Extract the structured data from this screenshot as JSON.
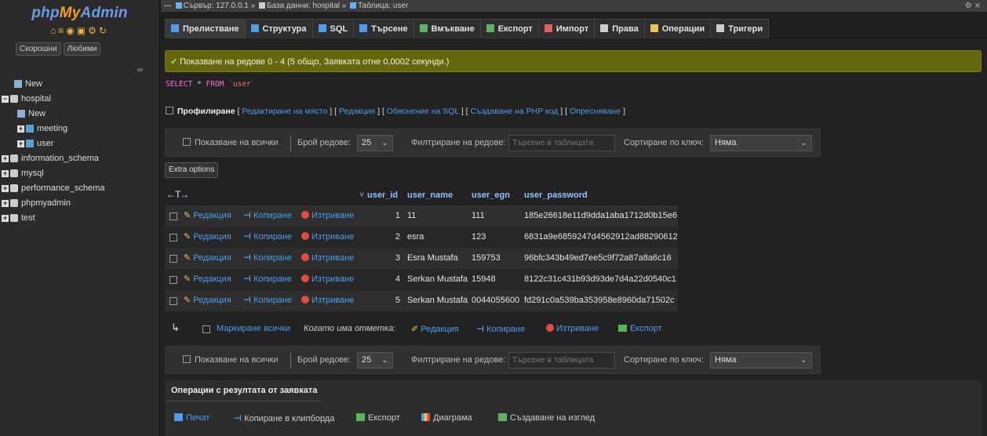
{
  "app": {
    "logo_php": "php",
    "logo_my": "My",
    "logo_admin": "Admin",
    "quick_icons": "⌂≡◉▣⚙↻"
  },
  "sidebar": {
    "recent": "Скорошни",
    "favorites": "Любими",
    "tree": [
      {
        "label": "New",
        "level": 1,
        "type": "new"
      },
      {
        "label": "hospital",
        "level": 0,
        "type": "db",
        "expanded": true
      },
      {
        "label": "New",
        "level": 2,
        "type": "new"
      },
      {
        "label": "meeting",
        "level": 2,
        "type": "table"
      },
      {
        "label": "user",
        "level": 2,
        "type": "table"
      },
      {
        "label": "information_schema",
        "level": 0,
        "type": "db"
      },
      {
        "label": "mysql",
        "level": 0,
        "type": "db"
      },
      {
        "label": "performance_schema",
        "level": 0,
        "type": "db"
      },
      {
        "label": "phpmyadmin",
        "level": 0,
        "type": "db"
      },
      {
        "label": "test",
        "level": 0,
        "type": "db"
      }
    ]
  },
  "breadcrumb": {
    "server": "Сървър: 127.0.0.1",
    "database": "База данни: hospital",
    "table": "Таблица: user",
    "right_icons": "⚙ ⨯"
  },
  "tabs": [
    {
      "label": "Прелистване",
      "color": "#4a9cf0"
    },
    {
      "label": "Структура",
      "color": "#4a9cf0"
    },
    {
      "label": "SQL",
      "color": "#4a9cf0"
    },
    {
      "label": "Търсене",
      "color": "#4a9cf0"
    },
    {
      "label": "Вмъкване",
      "color": "#58b858"
    },
    {
      "label": "Експорт",
      "color": "#58b858"
    },
    {
      "label": "Импорт",
      "color": "#e06060"
    },
    {
      "label": "Права",
      "color": "#ccc"
    },
    {
      "label": "Операции",
      "color": "#f2c14e"
    },
    {
      "label": "Тригери",
      "color": "#ccc"
    }
  ],
  "message": {
    "success": "Показване на редове 0 - 4 (5 общо, Заявката отне 0,0002 секунди.)"
  },
  "sql": {
    "select": "SELECT",
    "star": "*",
    "from": "FROM",
    "table": "`user`"
  },
  "profiling": {
    "label": "Профилиране",
    "inline_edit": "Редактиране на място",
    "edit": "Редакция",
    "explain": "Обяснение на SQL",
    "php_code": "Създаване на PHP код",
    "refresh": "Опресняване"
  },
  "nav": {
    "show_all": "Показване на всички",
    "rows_label": "Брой редове:",
    "rows_value": "25",
    "filter_label": "Филтриране на редове:",
    "filter_placeholder": "Търсене в таблицата",
    "sort_label": "Сортиране по ключ:",
    "sort_value": "Няма"
  },
  "extra_options": "Extra options",
  "table": {
    "columns": [
      "user_id",
      "user_name",
      "user_egn",
      "user_password"
    ],
    "actions": {
      "edit": "Редакция",
      "copy": "Копиране",
      "delete": "Изтриване"
    },
    "rows": [
      {
        "user_id": "1",
        "user_name": "11",
        "user_egn": "111",
        "user_password": "185e26618e11d9dda1aba1712d0b15e6"
      },
      {
        "user_id": "2",
        "user_name": "esra",
        "user_egn": "123",
        "user_password": "6831a9e6859247d4562912ad88290612"
      },
      {
        "user_id": "3",
        "user_name": "Esra Mustafa",
        "user_egn": "159753",
        "user_password": "96bfc343b49ed7ee5c9f72a87a8a6c16"
      },
      {
        "user_id": "4",
        "user_name": "Serkan Mustafa",
        "user_egn": "15948",
        "user_password": "8122c31c431b93d93de7d4a22d0540c1"
      },
      {
        "user_id": "5",
        "user_name": "Serkan Mustafa",
        "user_egn": "0044055600",
        "user_password": "fd291c0a539ba353958e8960da71502c"
      }
    ]
  },
  "bulk": {
    "check_all": "Маркиране всички",
    "with_selected": "Когато има отметка:",
    "edit": "Редакция",
    "copy": "Копиране",
    "delete": "Изтриване",
    "export": "Експорт"
  },
  "query_ops": {
    "title": "Операции с резултата от заявката",
    "print": "Печат",
    "copy_clipboard": "Копиране в клипборда",
    "export": "Експорт",
    "chart": "Диаграма",
    "create_view": "Създаване на изглед"
  }
}
